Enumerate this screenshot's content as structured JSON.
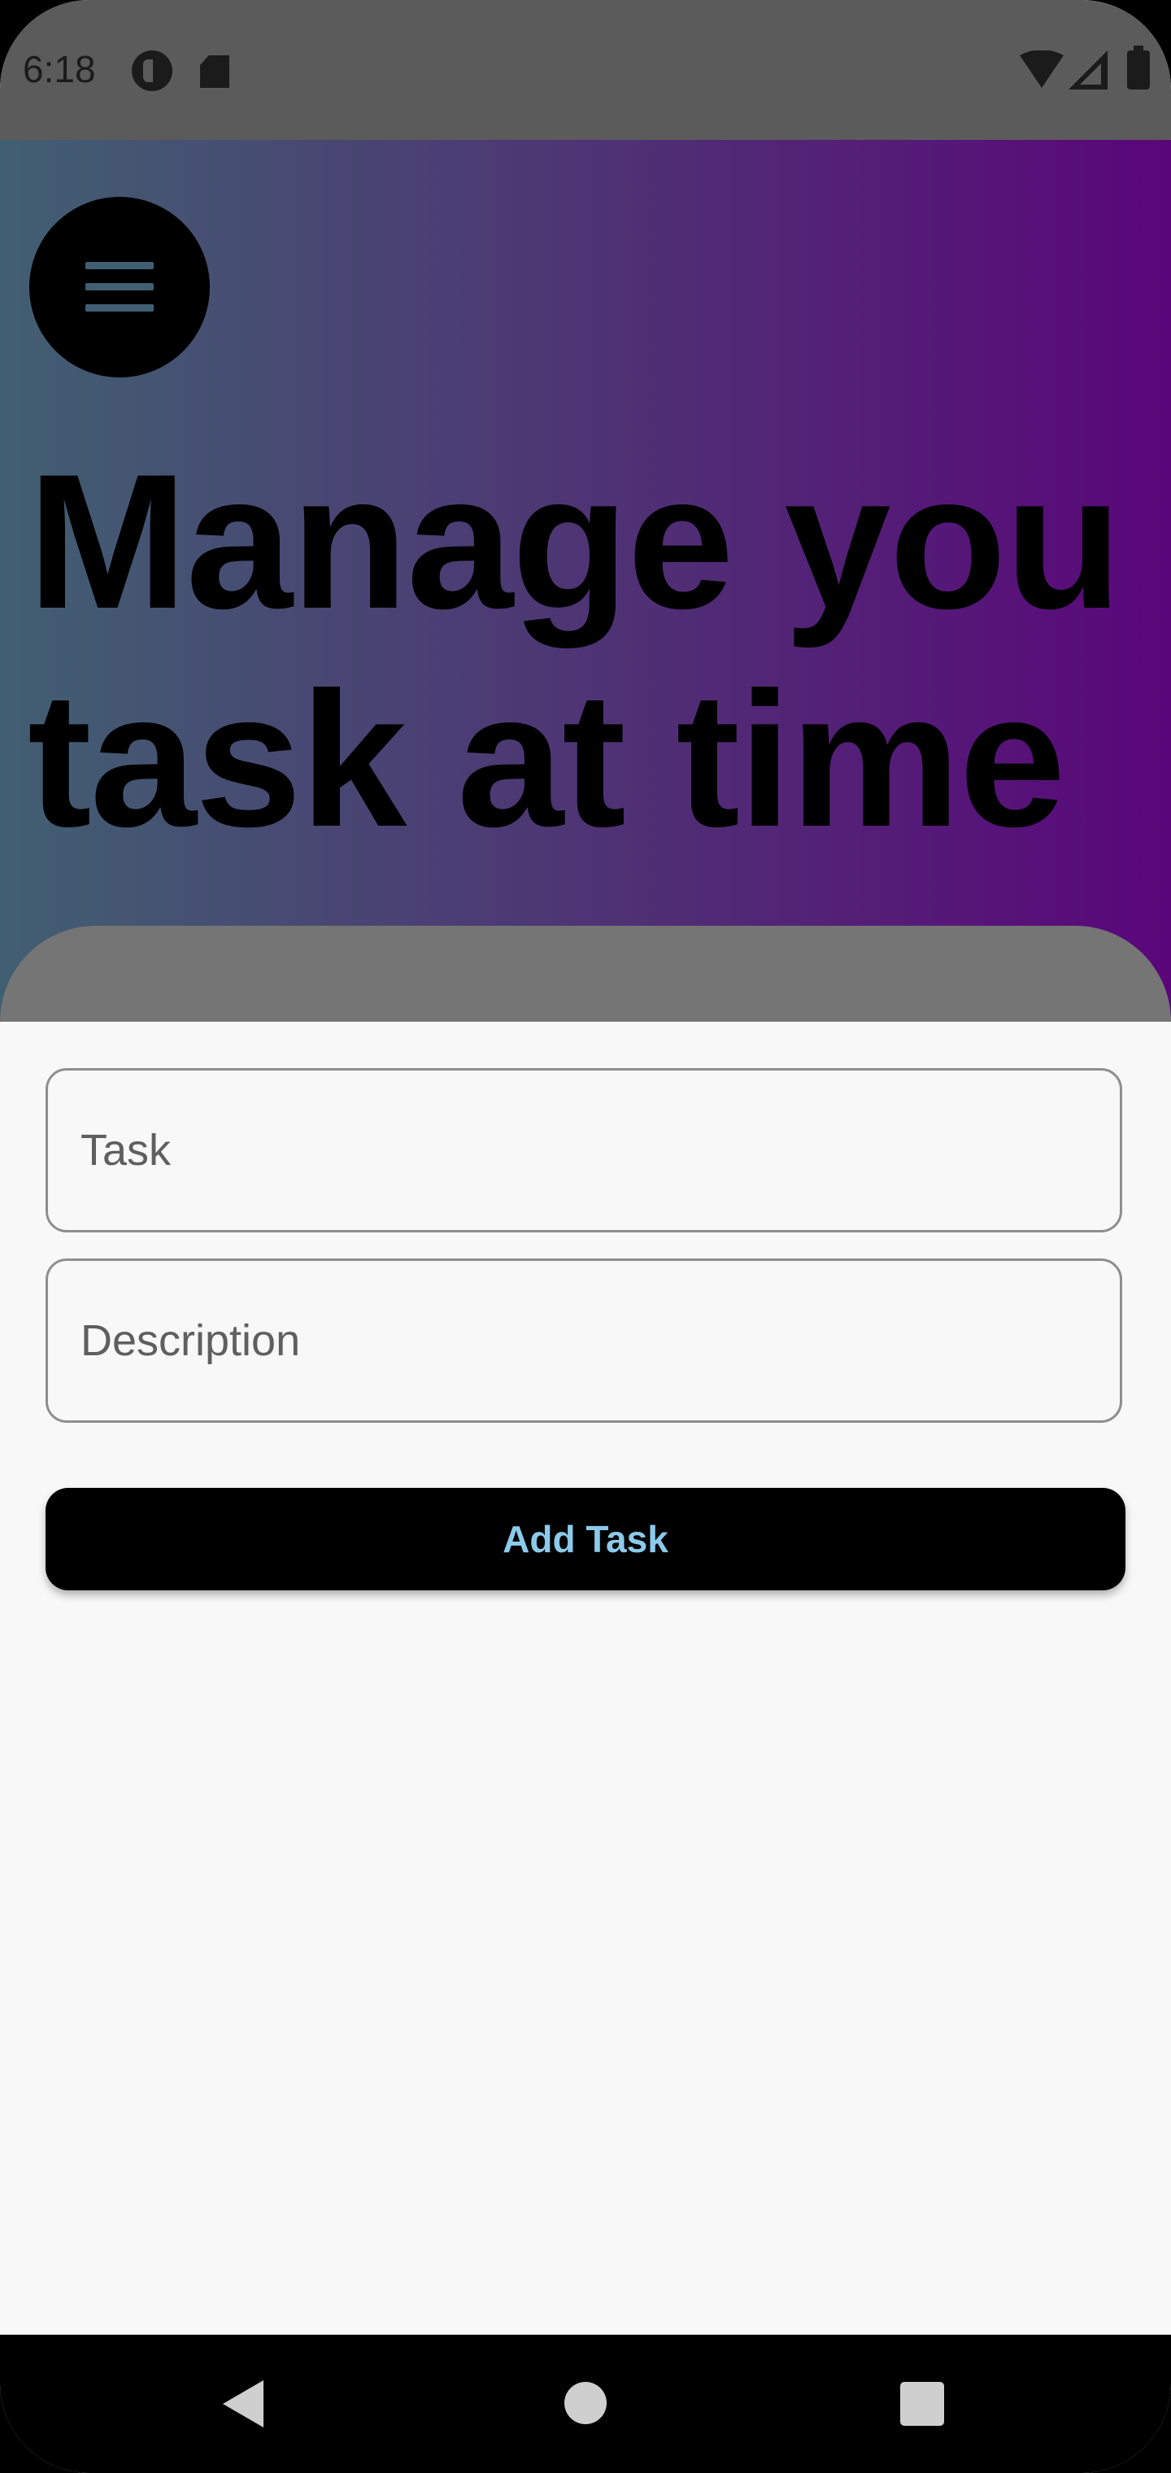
{
  "status_bar": {
    "time": "6:18",
    "icons": [
      "app-notification-icon",
      "sd-card-icon",
      "wifi-icon",
      "cell-signal-icon",
      "battery-icon"
    ]
  },
  "header": {
    "menu_icon": "hamburger-menu-icon",
    "title": "Manage you task at time",
    "gradient_colors": [
      "#415f72",
      "#4e3474",
      "#5a067a"
    ]
  },
  "form": {
    "task_placeholder": "Task",
    "description_placeholder": "Description",
    "add_button_label": "Add Task"
  },
  "colors": {
    "button_background": "#000000",
    "button_text": "#8ccaea",
    "page_background": "#f8f8f8"
  },
  "nav_bar": {
    "icons": [
      "back-icon",
      "home-icon",
      "recents-icon"
    ]
  }
}
